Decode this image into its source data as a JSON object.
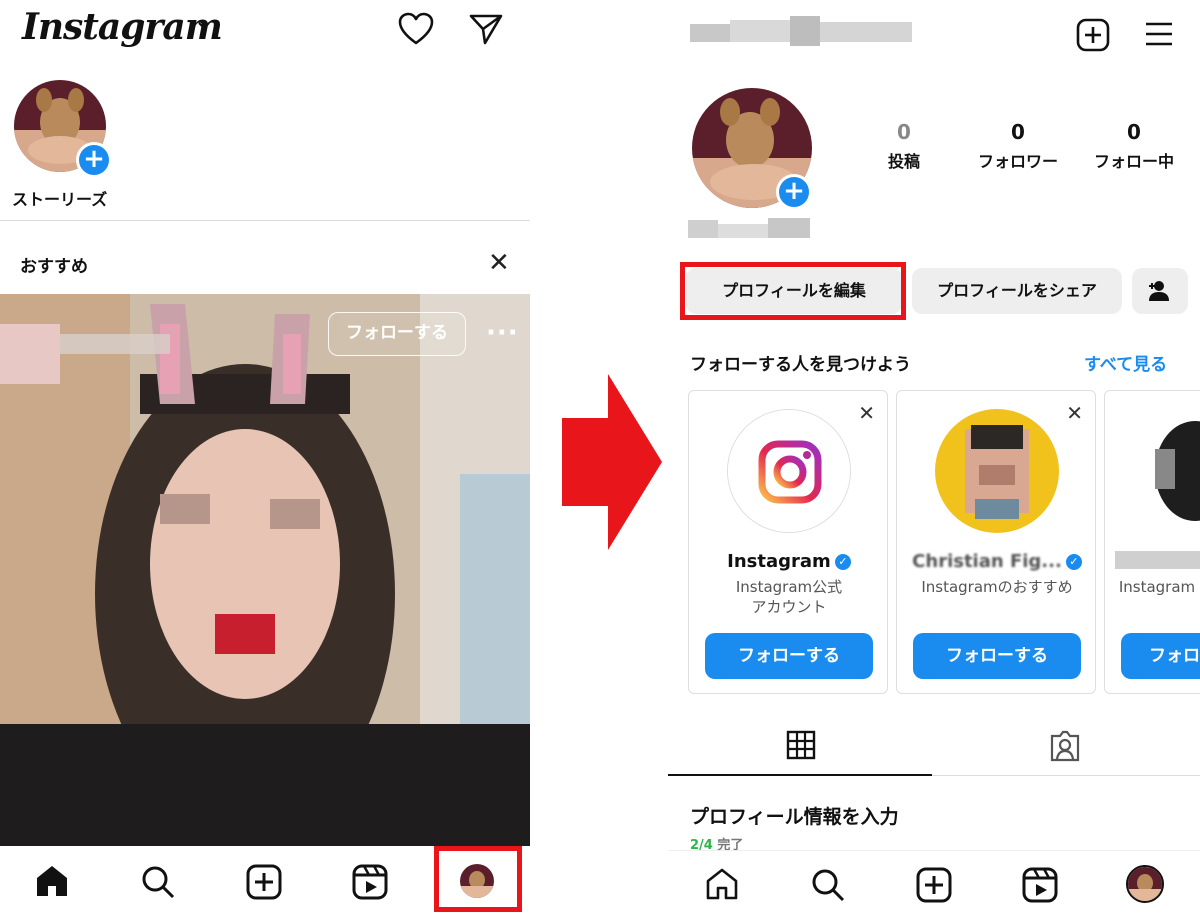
{
  "left_screen": {
    "app_logo": "Instagram",
    "story_label": "ストーリーズ",
    "recommended_label": "おすすめ",
    "post": {
      "follow_label": "フォローする",
      "more_label": "···"
    },
    "nav": [
      "home",
      "search",
      "create",
      "reels",
      "profile"
    ]
  },
  "right_screen": {
    "stats": [
      {
        "value": "0",
        "label": "投稿"
      },
      {
        "value": "0",
        "label": "フォロワー"
      },
      {
        "value": "0",
        "label": "フォロー中"
      }
    ],
    "buttons": {
      "edit_profile": "プロフィールを編集",
      "share_profile": "プロフィールをシェア"
    },
    "discover": {
      "title": "フォローする人を見つけよう",
      "see_all": "すべて見る",
      "cards": [
        {
          "name": "Instagram",
          "sub": "Instagram公式\nアカウント",
          "follow": "フォローする"
        },
        {
          "name": "Christian Fig...",
          "sub": "Instagramのおすすめ",
          "follow": "フォローする"
        },
        {
          "name": "",
          "sub": "Instagram",
          "follow": "フォロ"
        }
      ]
    },
    "profile_info": {
      "title": "プロフィール情報を入力",
      "progress": "2/4",
      "done": "完了"
    }
  },
  "colors": {
    "accent_blue": "#1a8cf0",
    "highlight_red": "#e8151b",
    "arrow_red": "#e8151b"
  }
}
